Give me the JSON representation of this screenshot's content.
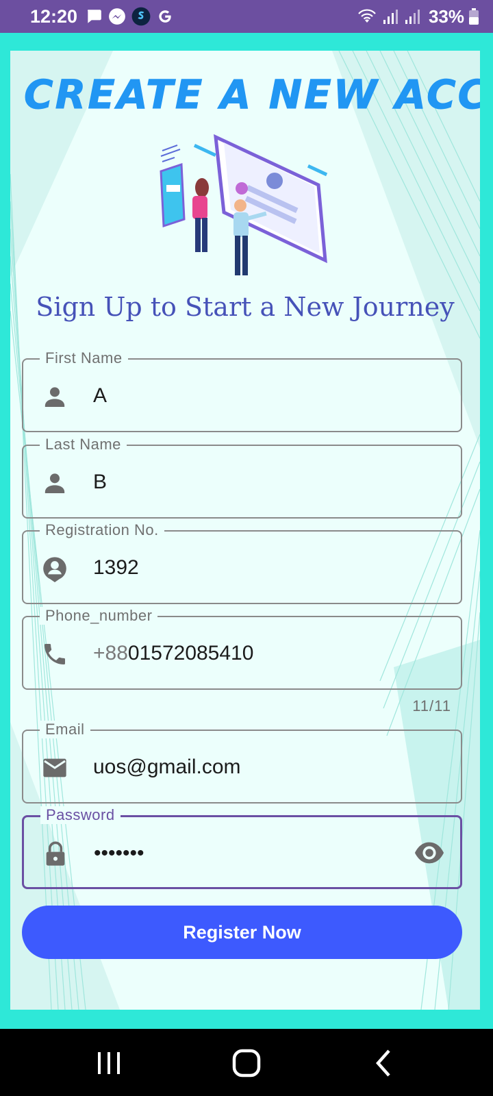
{
  "status_bar": {
    "time": "12:20",
    "battery": "33%",
    "left_icons": [
      "chat-bubble-icon",
      "messenger-icon",
      "app-s-icon",
      "google-g-icon"
    ],
    "right_icons": [
      "wifi-icon",
      "signal-icon",
      "signal-icon",
      "battery-icon"
    ]
  },
  "page": {
    "title": "CREATE A NEW ACCOUNT",
    "subtitle": "Sign Up to Start a New Journey"
  },
  "form": {
    "first_name": {
      "label": "First Name",
      "value": "A",
      "icon": "person-icon"
    },
    "last_name": {
      "label": "Last Name",
      "value": "B",
      "icon": "person-icon"
    },
    "registration": {
      "label": "Registration No.",
      "value": "1392",
      "icon": "account-circle-icon"
    },
    "phone": {
      "label": "Phone_number",
      "prefix": "+88",
      "value": "01572085410",
      "counter": "11/11",
      "icon": "phone-icon"
    },
    "email": {
      "label": "Email",
      "value": "uos@gmail.com",
      "icon": "mail-icon"
    },
    "password": {
      "label": "Password",
      "value": "•••••••",
      "icon": "lock-icon",
      "toggle_icon": "eye-icon"
    }
  },
  "actions": {
    "register_label": "Register Now"
  },
  "colors": {
    "accent": "#3d5afe",
    "title": "#2196f3",
    "focus": "#6a4fa3",
    "frame": "#2ee8d8",
    "status_bar": "#6c4fa0"
  }
}
